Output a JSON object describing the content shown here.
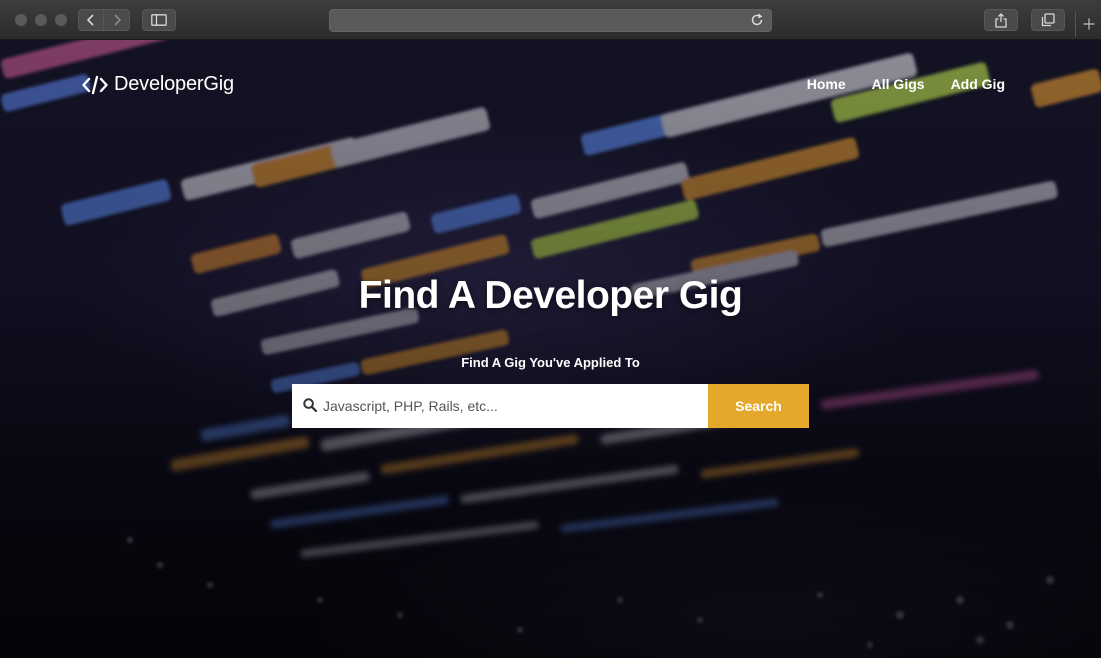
{
  "browser": {
    "controls": [
      "close",
      "minimize",
      "zoom"
    ],
    "icons": {
      "back": "chevron-left-icon",
      "forward": "chevron-right-icon",
      "sidebar": "sidebar-icon",
      "reload": "reload-icon",
      "share": "share-icon",
      "tabs": "tabs-overview-icon",
      "new_tab": "plus-icon"
    }
  },
  "brand": {
    "name": "DeveloperGig",
    "icon": "code-brackets-icon"
  },
  "nav": {
    "items": [
      {
        "label": "Home"
      },
      {
        "label": "All Gigs"
      },
      {
        "label": "Add Gig"
      }
    ]
  },
  "hero": {
    "title": "Find A Developer Gig",
    "subtitle": "Find A Gig You've Applied To"
  },
  "search": {
    "icon": "search-icon",
    "placeholder": "Javascript, PHP, Rails, etc...",
    "value": "",
    "button_label": "Search"
  },
  "colors": {
    "accent": "#e5a82a",
    "text": "#ffffff",
    "chrome": "#333333"
  }
}
